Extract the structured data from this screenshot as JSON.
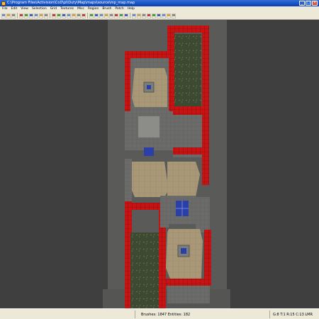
{
  "window": {
    "title": "C:\\Program Files\\Activision\\CoD\\pl\\Duty\\Map\\maps\\source\\mp_map.map",
    "icon": "editor-app-icon"
  },
  "menu": {
    "items": [
      "File",
      "Edit",
      "View",
      "Selection",
      "Grid",
      "Textures",
      "Misc",
      "Region",
      "Brush",
      "Patch",
      "Help"
    ]
  },
  "toolbar": {
    "icons": [
      "open-icon",
      "save-icon",
      "cut-icon",
      "flip-x-icon",
      "flip-y-icon",
      "flip-z-icon",
      "rotate-x-icon",
      "rotate-y-icon",
      "rotate-z-icon",
      "select-icon",
      "select-touching-icon",
      "select-inside-icon",
      "csg-subtract-icon",
      "csg-merge-icon",
      "hollow-icon",
      "clipper-icon",
      "camera-icon",
      "brush-icon",
      "texture-icon",
      "grid-icon",
      "patch-icon",
      "vertex-icon",
      "edge-icon",
      "face-icon",
      "scale-icon",
      "rotate-icon",
      "lock-icon",
      "light-icon",
      "entity-icon",
      "cube-icon",
      "patch-matrix-icon",
      "snap-icon",
      "stats-icon"
    ]
  },
  "status": {
    "brushes_entities": "Brushes: 1847 Entities: 182",
    "grid_info": "G:8 T:1 R:15 C:13 LMR"
  },
  "colors": {
    "void": "#3f3f3f",
    "corridor": "#5a5a58",
    "wall_red": "#c61414",
    "grass": "#3f4a33",
    "sand": "#a99878",
    "stone": "#747474",
    "blue_marker": "#2a3fa8"
  }
}
